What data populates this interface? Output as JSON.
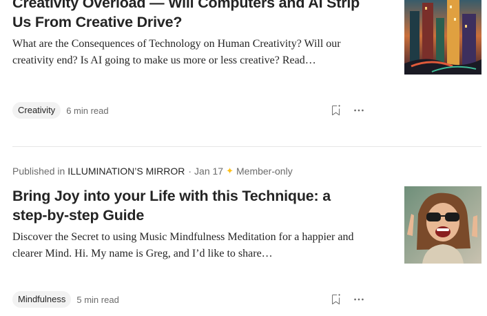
{
  "articles": [
    {
      "title": "Creativity Overload — Will Computers and AI Strip Us From Creative Drive?",
      "snippet": "What are the Consequences of Technology on Human Creativity? Will our creativity end? Is AI going to make us more or less creative? Read…",
      "tag": "Creativity",
      "read_time": "6 min read",
      "thumbnail": "futuristic-city-painting"
    },
    {
      "published_prefix": "Published in",
      "publication": "ILLUMINATION’S MIRROR",
      "separator": "·",
      "date": "Jan 17",
      "member_badge": "Member-only",
      "title": "Bring Joy into your Life with this Technique: a step-by-step Guide",
      "snippet": "Discover the Secret to using Music Mindfulness Meditation for a happier and clearer Mind. Hi. My name is Greg, and I’d like to share…",
      "tag": "Mindfulness",
      "read_time": "5 min read",
      "thumbnail": "joyful-woman-sunglasses-photo"
    }
  ],
  "icons": {
    "save": "bookmark-add-icon",
    "more": "more-options-icon",
    "member": "sparkle-star-icon"
  },
  "colors": {
    "member_star": "#ffc017",
    "muted_text": "#6b6b6b",
    "tag_bg": "#f2f2f2"
  }
}
